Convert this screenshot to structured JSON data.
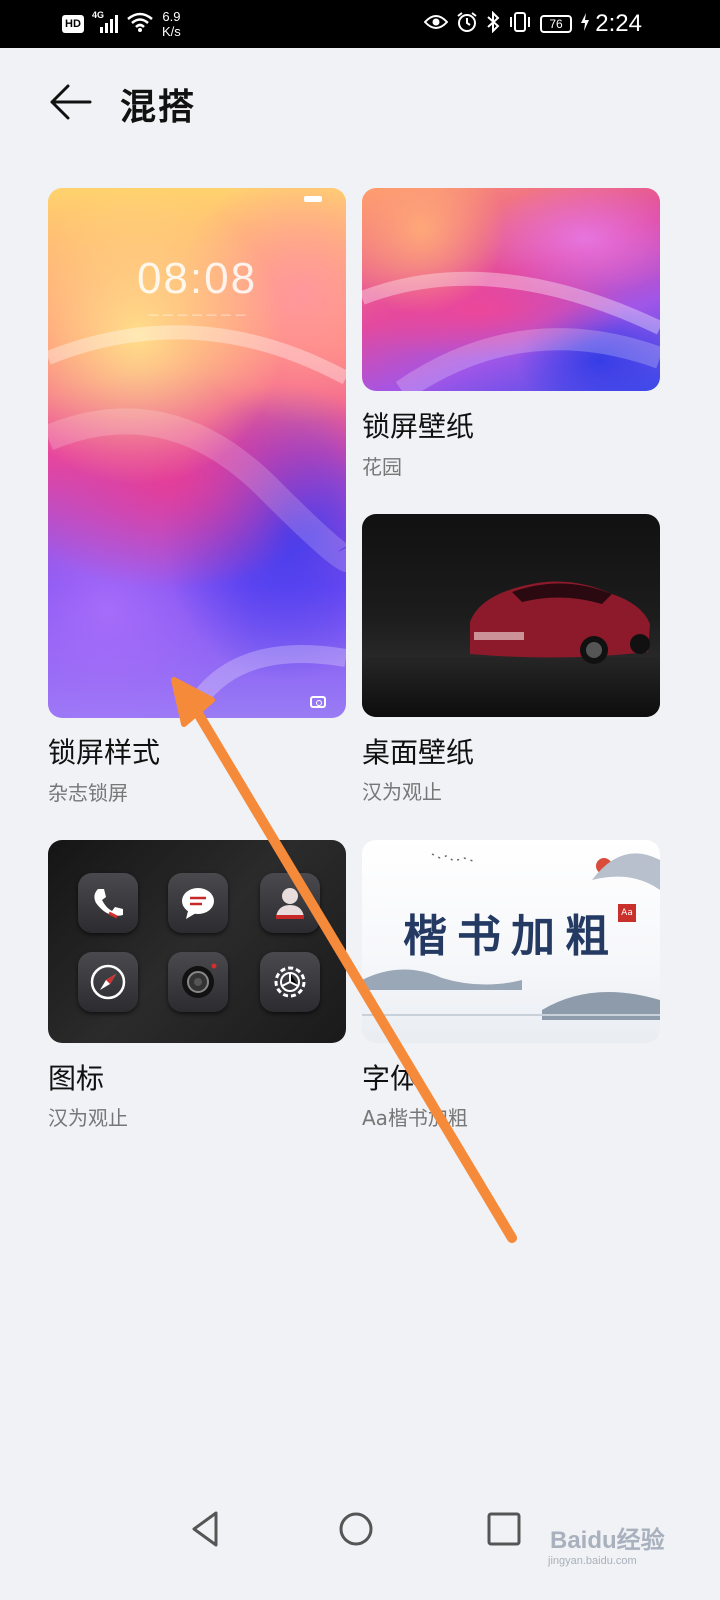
{
  "status_bar": {
    "hd": "HD",
    "network": "4G",
    "speed_value": "6.9",
    "speed_unit": "K/s",
    "battery": "76",
    "time": "2:24"
  },
  "header": {
    "title": "混搭"
  },
  "cards": {
    "lock_style": {
      "title": "锁屏样式",
      "subtitle": "杂志锁屏",
      "preview_clock": "08:08"
    },
    "lock_wallpaper": {
      "title": "锁屏壁纸",
      "subtitle": "花园"
    },
    "desktop_wallpaper": {
      "title": "桌面壁纸",
      "subtitle": "汉为观止"
    },
    "icons": {
      "title": "图标",
      "subtitle": "汉为观止"
    },
    "font": {
      "title": "字体",
      "subtitle": "Aa楷书加粗",
      "preview_text": "楷书加粗",
      "seal_text": "Aa"
    }
  },
  "watermark": {
    "logo": "Baidu经验",
    "url": "jingyan.baidu.com"
  },
  "colors": {
    "background": "#f1f2f5",
    "annotation_arrow": "#f58a3a",
    "font_preview": "#243a63"
  }
}
